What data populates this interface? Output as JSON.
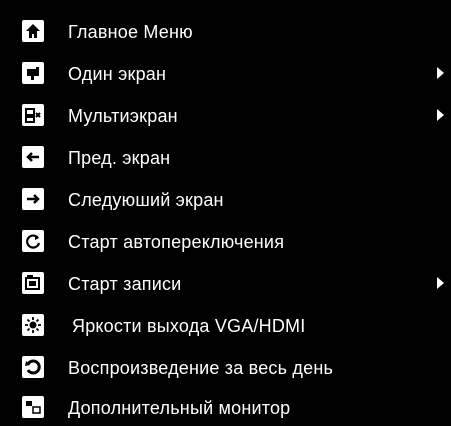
{
  "menu": {
    "items": [
      {
        "label": "Главное Меню",
        "icon": "home-icon",
        "submenu": false
      },
      {
        "label": "Один экран",
        "icon": "single-screen-icon",
        "submenu": true
      },
      {
        "label": "Мультиэкран",
        "icon": "multi-screen-icon",
        "submenu": true
      },
      {
        "label": "Пред. экран",
        "icon": "arrow-left-icon",
        "submenu": false
      },
      {
        "label": "Следуюший экран",
        "icon": "arrow-right-icon",
        "submenu": false
      },
      {
        "label": "Старт автопереключения",
        "icon": "refresh-icon",
        "submenu": false
      },
      {
        "label": "Старт записи",
        "icon": "record-icon",
        "submenu": true
      },
      {
        "label": "Яркости выхода VGA/HDMI",
        "icon": "brightness-icon",
        "submenu": false
      },
      {
        "label": "Воспроизведение за весь день",
        "icon": "playback-icon",
        "submenu": false
      },
      {
        "label": "Дополнительный монитор",
        "icon": "aux-monitor-icon",
        "submenu": false
      }
    ]
  },
  "colors": {
    "background": "#000000",
    "text": "#ffffff",
    "icon_fill": "#ffffff",
    "icon_glyph": "#000000"
  }
}
